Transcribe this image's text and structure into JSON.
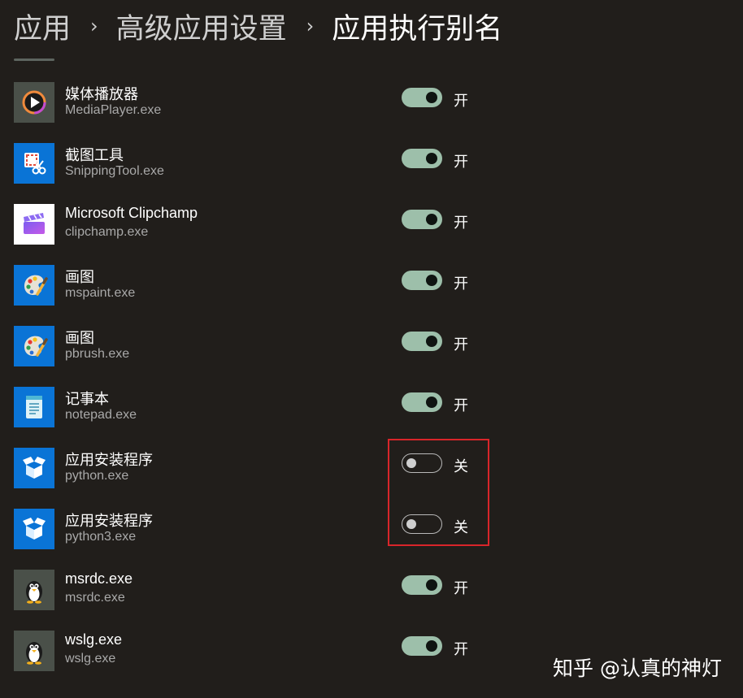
{
  "breadcrumb": {
    "items": [
      "应用",
      "高级应用设置",
      "应用执行别名"
    ],
    "separator": "›"
  },
  "apps": [
    {
      "name": "媒体播放器",
      "exe": "MediaPlayer.exe",
      "enabled": true,
      "state_label": "开",
      "icon": "media-player-icon"
    },
    {
      "name": "截图工具",
      "exe": "SnippingTool.exe",
      "enabled": true,
      "state_label": "开",
      "icon": "snipping-tool-icon"
    },
    {
      "name": "Microsoft Clipchamp",
      "exe": "clipchamp.exe",
      "enabled": true,
      "state_label": "开",
      "icon": "clipchamp-icon"
    },
    {
      "name": "画图",
      "exe": "mspaint.exe",
      "enabled": true,
      "state_label": "开",
      "icon": "paint-icon"
    },
    {
      "name": "画图",
      "exe": "pbrush.exe",
      "enabled": true,
      "state_label": "开",
      "icon": "paint-icon"
    },
    {
      "name": "记事本",
      "exe": "notepad.exe",
      "enabled": true,
      "state_label": "开",
      "icon": "notepad-icon"
    },
    {
      "name": "应用安装程序",
      "exe": "python.exe",
      "enabled": false,
      "state_label": "关",
      "icon": "app-installer-icon"
    },
    {
      "name": "应用安装程序",
      "exe": "python3.exe",
      "enabled": false,
      "state_label": "关",
      "icon": "app-installer-icon"
    },
    {
      "name": "msrdc.exe",
      "exe": "msrdc.exe",
      "enabled": true,
      "state_label": "开",
      "icon": "penguin-icon"
    },
    {
      "name": "wslg.exe",
      "exe": "wslg.exe",
      "enabled": true,
      "state_label": "开",
      "icon": "penguin-icon"
    }
  ],
  "watermark": "知乎 @认真的神灯",
  "colors": {
    "background": "#211e1b",
    "toggle_on": "#9dbfaa",
    "highlight": "#d9252a",
    "secondary_text": "#a9a9a9"
  }
}
